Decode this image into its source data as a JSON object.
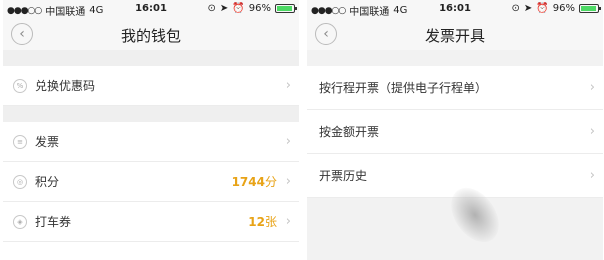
{
  "status_bar": {
    "carrier": "中国联通",
    "network": "4G",
    "time": "16:01",
    "battery": "96%"
  },
  "left_screen": {
    "title": "我的钱包",
    "redeem_label": "兑换优惠码",
    "items": [
      {
        "label": "发票",
        "icon": "invoice-icon"
      },
      {
        "label": "积分",
        "icon": "points-icon",
        "value": "1744",
        "unit": "分"
      },
      {
        "label": "打车券",
        "icon": "coupon-icon",
        "value": "12",
        "unit": "张"
      }
    ]
  },
  "right_screen": {
    "title": "发票开具",
    "items": [
      {
        "label": "按行程开票（提供电子行程单）"
      },
      {
        "label": "按金额开票"
      },
      {
        "label": "开票历史"
      }
    ]
  },
  "colors": {
    "accent_value": "#e8a317",
    "page_bg": "#efefef",
    "bar_bg": "#f7f7f7"
  }
}
